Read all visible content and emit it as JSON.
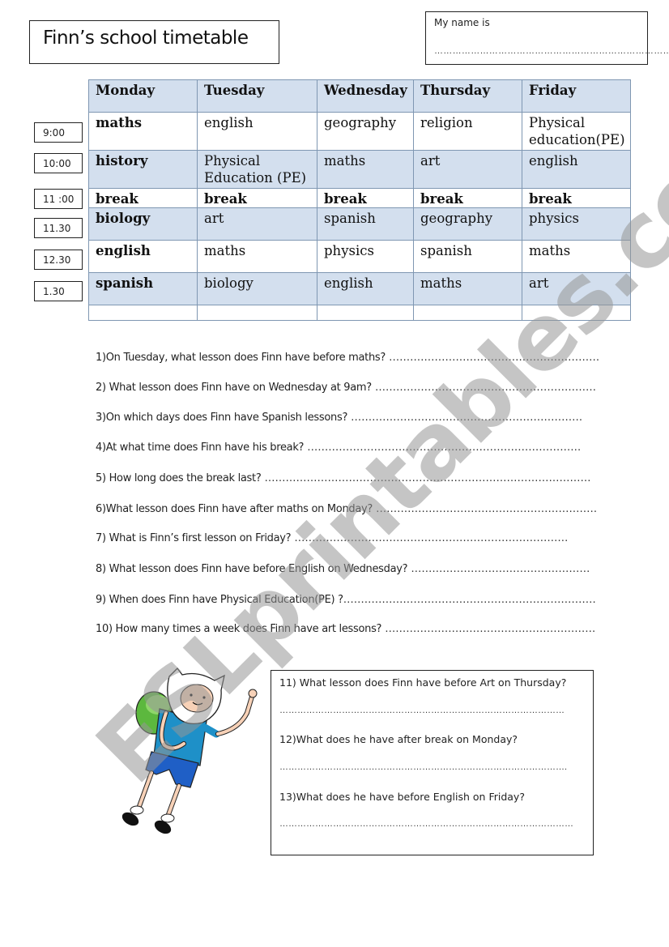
{
  "header": {
    "title": "Finn’s school timetable",
    "name_label": "My name is",
    "name_dots": "……………………………………………………………………"
  },
  "times": [
    "9:00",
    "10:00",
    "11 :00",
    "11.30",
    "12.30",
    "1.30"
  ],
  "timetable": {
    "days": [
      "Monday",
      "Tuesday",
      "Wednesday",
      "Thursday",
      "Friday"
    ],
    "rows": [
      [
        "maths",
        "english",
        "geography",
        "religion",
        "Physical education(PE)"
      ],
      [
        "history",
        "Physical Education (PE)",
        "maths",
        "art",
        "english"
      ],
      [
        "break",
        "break",
        "break",
        "break",
        "break"
      ],
      [
        "biology",
        "art",
        "spanish",
        "geography",
        "physics"
      ],
      [
        "english",
        "maths",
        "physics",
        "spanish",
        "maths"
      ],
      [
        "spanish",
        "biology",
        "english",
        "maths",
        "art"
      ],
      [
        "",
        "",
        "",
        "",
        ""
      ]
    ]
  },
  "questions": [
    {
      "text": "1)On Tuesday, what lesson does Finn have before maths?",
      "dots": " ……………………………………………………"
    },
    {
      "text": "2) What lesson does Finn have on Wednesday at 9am?",
      "dots": " ………………………………………………………"
    },
    {
      "text": "3)On which days does Finn have Spanish lessons?",
      "dots": " …………………………………………………………"
    },
    {
      "text": "4)At what time does Finn have his break?",
      "dots": " ……………………………………………………………………"
    },
    {
      "text": "5) How long does the break last?",
      "dots": " …………………………………………………………………………………"
    },
    {
      "text": "6)What lesson does Finn have after maths on Monday?",
      "dots": " ………………………………………………………"
    },
    {
      "text": "7) What is Finn’s first lesson on Friday?",
      "dots": " ……………………………………………………………………"
    },
    {
      "text": "8) What lesson does Finn have before English on Wednesday?",
      "dots": " ……………………………………………"
    },
    {
      "text": "9) When does Finn have Physical Education(PE) ?",
      "dots": "………………………………………………………………"
    },
    {
      "text": "10) How many times a week does Finn have art lessons?",
      "dots": " ……………………………………………………"
    }
  ],
  "box_questions": [
    {
      "text": "11) What lesson does Finn have before Art on Thursday?",
      "dots": "……………………………………………………………………………………"
    },
    {
      "text": "12)What does he have after break on Monday?",
      "dots": "……………………………………………………………………………………."
    },
    {
      "text": "13)What does he have before English on Friday?",
      "dots": "………………………………………………………………………………………"
    }
  ],
  "watermark": "ESLprintables.com",
  "colors": {
    "header_shade": "#d3dfee",
    "table_border": "#7f97b2"
  }
}
